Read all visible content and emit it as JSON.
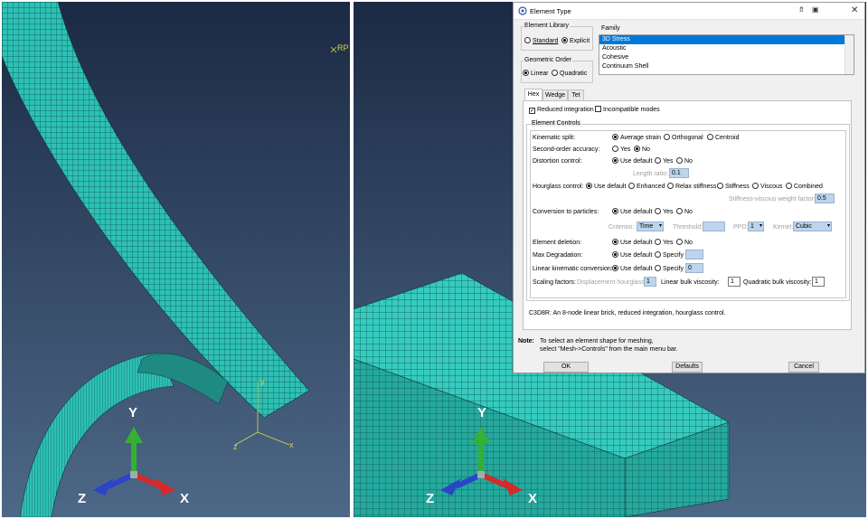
{
  "viewports": {
    "left": {
      "rp_label": "RP",
      "axis": {
        "x": "X",
        "y": "Y",
        "z": "Z"
      },
      "mini_axis": {
        "x": "x",
        "y": "y",
        "z": "z"
      }
    },
    "right": {
      "axis": {
        "x": "X",
        "y": "Y",
        "z": "Z"
      }
    }
  },
  "dialog": {
    "title": "Element Type",
    "element_library": {
      "label": "Element Library",
      "options": [
        "Standard",
        "Explicit"
      ],
      "selected": "Explicit"
    },
    "family": {
      "label": "Family",
      "items": [
        "3D Stress",
        "Acoustic",
        "Cohesive",
        "Continuum Shell"
      ],
      "selected": "3D Stress"
    },
    "geometric_order": {
      "label": "Geometric Order",
      "options": [
        "Linear",
        "Quadratic"
      ],
      "selected": "Linear"
    },
    "tabs": [
      "Hex",
      "Wedge",
      "Tet"
    ],
    "active_tab": "Hex",
    "reduced_integration": "Reduced integration",
    "incompatible_modes": "Incompatible modes",
    "element_controls_label": "Element Controls",
    "controls": {
      "kinematic_split": {
        "label": "Kinematic split:",
        "options": [
          "Average strain",
          "Orthogonal",
          "Centroid"
        ]
      },
      "second_order": {
        "label": "Second-order accuracy:",
        "options": [
          "Yes",
          "No"
        ]
      },
      "distortion": {
        "label": "Distortion control:",
        "options": [
          "Use default",
          "Yes",
          "No"
        ]
      },
      "length_ratio": {
        "label": "Length ratio:",
        "value": "0.1"
      },
      "hourglass": {
        "label": "Hourglass control:",
        "options": [
          "Use default",
          "Enhanced",
          "Relax stiffness",
          "Stiffness",
          "Viscous",
          "Combined"
        ]
      },
      "stiffness_viscous": {
        "label": "Stiffness-viscous weight factor:",
        "value": "0.5"
      },
      "conversion": {
        "label": "Conversion to particles:",
        "options": [
          "Use default",
          "Yes",
          "No"
        ]
      },
      "criterion": {
        "label": "Criterion:",
        "value": "Time"
      },
      "threshold": {
        "label": "Threshold:",
        "value": ""
      },
      "ppd": {
        "label": "PPD:",
        "value": "1"
      },
      "kernel": {
        "label": "Kernel:",
        "value": "Cubic"
      },
      "element_deletion": {
        "label": "Element deletion:",
        "options": [
          "Use default",
          "Yes",
          "No"
        ]
      },
      "max_degradation": {
        "label": "Max Degradation:",
        "options": [
          "Use default",
          "Specify"
        ],
        "value": ""
      },
      "linear_kinematic": {
        "label": "Linear kinematic conversion:",
        "options": [
          "Use default",
          "Specify"
        ],
        "value": "0"
      },
      "scaling": {
        "label": "Scaling factors:",
        "disp_hourglass_label": "Displacement hourglass:",
        "disp_hourglass_value": "1",
        "linear_bulk_label": "Linear bulk viscosity:",
        "linear_bulk_value": "1",
        "quad_bulk_label": "Quadratic bulk viscosity:",
        "quad_bulk_value": "1"
      }
    },
    "description": "C3D8R:  An 8-node linear brick, reduced integration, hourglass control.",
    "note_label": "Note:",
    "note_line1": "To select an element shape for meshing,",
    "note_line2": "select \"Mesh->Controls\" from the main menu bar.",
    "buttons": {
      "ok": "OK",
      "defaults": "Defaults",
      "cancel": "Cancel"
    }
  },
  "colors": {
    "mesh": "#2ec0b4",
    "background_top": "#1b2a44",
    "background_bottom": "#4a6584",
    "x_axis": "#d42a2a",
    "y_axis": "#34b034",
    "z_axis": "#2a45c8",
    "selected": "#0078d7"
  }
}
